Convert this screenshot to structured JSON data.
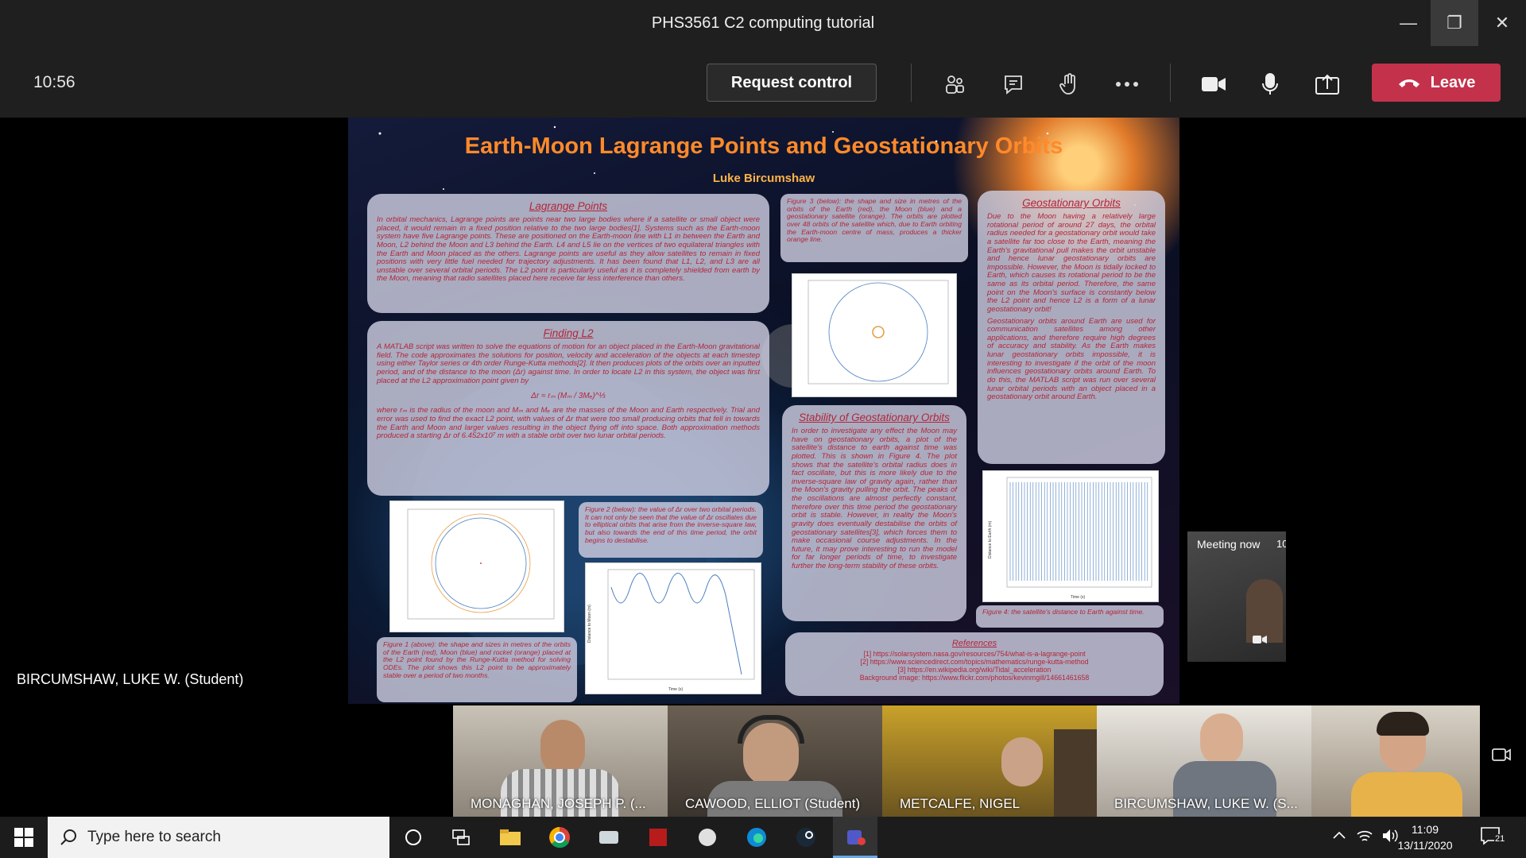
{
  "window": {
    "title": "PHS3561 C2 computing tutorial",
    "minimize_icon": "minimize-icon",
    "restore_icon": "restore-icon",
    "close_icon": "close-icon"
  },
  "meeting_toolbar": {
    "elapsed_time": "10:56",
    "request_control_label": "Request control",
    "leave_label": "Leave",
    "icons": [
      "participants-icon",
      "chat-icon",
      "raise-hand-icon",
      "more-options-icon",
      "camera-icon",
      "microphone-icon",
      "share-screen-icon",
      "phone-hangup-icon"
    ],
    "leave_color": "#c4314b"
  },
  "presenter_label": "BIRCUMSHAW, LUKE W. (Student)",
  "poster": {
    "title": "Earth-Moon Lagrange Points and Geostationary Orbits",
    "author": "Luke Bircumshaw",
    "title_color": "#ff8a2a",
    "text_color": "#b3263a",
    "lagrange": {
      "heading": "Lagrange Points",
      "body": "In orbital mechanics, Lagrange points are points near two large bodies where if a satellite or small object were placed, it would remain in a fixed position relative to the two large bodies[1]. Systems such as the Earth-moon system have five Lagrange points. These are positioned on the Earth-moon line with L1 in between the Earth and Moon, L2 behind the Moon and L3 behind the Earth. L4 and L5 lie on the vertices of two equilateral triangles with the Earth and Moon placed as the others. Lagrange points are useful as they allow satellites to remain in fixed positions with very little fuel needed for trajectory adjustments. It has been found that L1, L2, and L3 are all unstable over several orbital periods. The L2 point is particularly useful as it is completely shielded from earth by the Moon, meaning that radio satellites placed here receive far less interference than others."
    },
    "finding_l2": {
      "heading": "Finding L2",
      "body1": "A MATLAB script was written to solve the equations of motion for an object placed in the Earth-Moon gravitational field. The code approximates the solutions for position, velocity and acceleration of the objects at each timestep using either Taylor series or 4th order Runge-Kutta methods[2]. It then produces plots of the orbits over an inputted period, and of the distance to the moon (Δr) against time. In order to locate L2 in this system, the object was first placed at the L2 approximation point given by",
      "equation": "Δr ≈ rₘ (Mₘ / 3Mₑ)^⅓",
      "body2": "where rₘ is the radius of the moon and Mₘ and Mₑ are the masses of the Moon and Earth respectively. Trial and error was used to find the exact L2 point, with values of Δr that were too small producing orbits that fell in towards the Earth and Moon and larger values resulting in the object flying off into space. Both approximation methods produced a starting Δr of 6.452x10⁷ m with a stable orbit over two lunar orbital periods."
    },
    "fig3_caption": "Figure 3 (below): the shape and size in metres of the orbits of the Earth (red), the Moon (blue) and a geostationary satellite (orange). The orbits are plotted over 48 orbits of the satellite which, due to Earth orbiting the Earth-moon centre of mass, produces a thicker orange line.",
    "stability": {
      "heading": "Stability of Geostationary Orbits",
      "body": "In order to investigate any effect the Moon may have on geostationary orbits, a plot of the satellite's distance to earth against time was plotted. This is shown in Figure 4. The plot shows that the satellite's orbital radius does in fact oscillate, but this is more likely due to the inverse-square law of gravity again, rather than the Moon's gravity pulling the orbit. The peaks of the oscillations are almost perfectly constant, therefore over this time period the geostationary orbit is stable. However, in reality the Moon's gravity does eventually destabilise the orbits of geostationary satellites[3], which forces them to make occasional course adjustments. In the future, it may prove interesting to run the model for far longer periods of time, to investigate further the long-term stability of these orbits."
    },
    "geostationary": {
      "heading": "Geostationary Orbits",
      "body1": "Due to the Moon having a relatively large rotational period of around 27 days, the orbital radius needed for a geostationary orbit would take a satellite far too close to the Earth, meaning the Earth's gravitational pull makes the orbit unstable and hence lunar geostationary orbits are impossible. However, the Moon is tidally locked to Earth, which causes its rotational period to be the same as its orbital period. Therefore, the same point on the Moon's surface is constantly below the L2 point and hence L2 is a form of a lunar geostationary orbit!",
      "body2": "Geostationary orbits around Earth are used for communication satellites among other applications, and therefore require high degrees of accuracy and stability. As the Earth makes lunar geostationary orbits impossible, it is interesting to investigate if the orbit of the moon influences geostationary orbits around Earth. To do this, the MATLAB script was run over several lunar orbital periods with an object placed in a geostationary orbit around Earth."
    },
    "fig1_caption": "Figure 1 (above): the shape and sizes in metres of the orbits of the Earth (red), Moon (blue) and rocket (orange) placed at the L2 point found by the Runge-Kutta method for solving ODEs. The plot shows this L2 point to be approximately stable over a period of two months.",
    "fig2_caption": "Figure 2 (below): the value of Δr over two orbital periods. It can not only be seen that the value of Δr oscillates due to elliptical orbits that arise from the inverse-square law, but also towards the end of this time period, the orbit begins to destabilise.",
    "fig4_caption": "Figure 4: the satellite's distance to Earth against time.",
    "references": {
      "heading": "References",
      "items": [
        "[1] https://solarsystem.nasa.gov/resources/754/what-is-a-lagrange-point",
        "[2] https://www.sciencedirect.com/topics/mathematics/runge-kutta-method",
        "[3] https://en.wikipedia.org/wiki/Tidal_acceleration",
        "Background image: https://www.flickr.com/photos/kevinmgill/14661461658"
      ]
    },
    "fig2_ylabel": "Distance to Moon (m)",
    "fig2_xlabel": "Time (s)",
    "fig4_ylabel": "Distance to Earth (m)",
    "fig4_xlabel": "Time (s)"
  },
  "self_view": {
    "badge": "Meeting now",
    "badge_suffix": "10"
  },
  "participants": [
    {
      "name": "MONAGHAN, JOSEPH P. (..."
    },
    {
      "name": "CAWOOD, ELLIOT (Student)"
    },
    {
      "name": "METCALFE, NIGEL"
    },
    {
      "name": "BIRCUMSHAW, LUKE W. (S..."
    },
    {
      "name": ""
    }
  ],
  "taskbar": {
    "search_placeholder": "Type here to search",
    "time": "11:09",
    "date": "13/11/2020",
    "notification_count": "21",
    "apps": [
      "cortana-icon",
      "task-view-icon",
      "file-explorer-icon",
      "chrome-icon",
      "app-icon",
      "app-icon",
      "app-icon",
      "edge-icon",
      "steam-icon",
      "teams-icon"
    ]
  }
}
